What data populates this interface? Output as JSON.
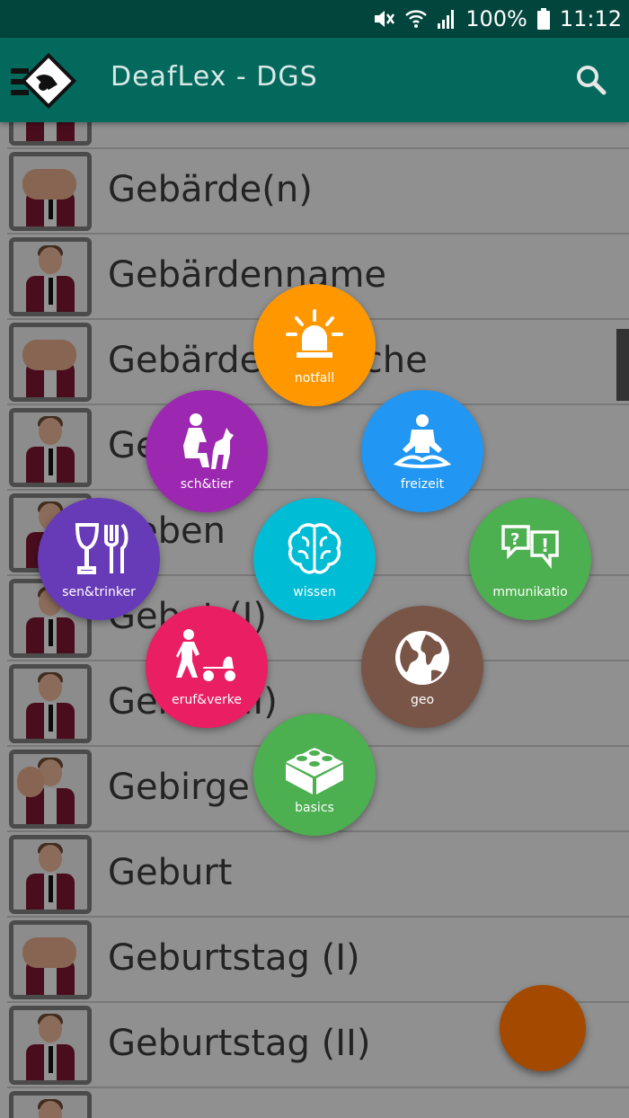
{
  "status_bar": {
    "battery": "100%",
    "time": "11:12"
  },
  "app_bar": {
    "title": "DeafLex - DGS"
  },
  "list": {
    "items": [
      {
        "label": ""
      },
      {
        "label": "Gebärde(n)"
      },
      {
        "label": "Gebärdenname"
      },
      {
        "label": "Gebärdensprache"
      },
      {
        "label": "Gehen"
      },
      {
        "label": "Geben"
      },
      {
        "label": "Gebet (I)"
      },
      {
        "label": "Gebet (II)"
      },
      {
        "label": "Gebirge"
      },
      {
        "label": "Geburt"
      },
      {
        "label": "Geburtstag (I)"
      },
      {
        "label": "Geburtstag (II)"
      },
      {
        "label": ""
      }
    ]
  },
  "radial_menu": {
    "notfall": {
      "label": "notfall",
      "color": "#ff9800"
    },
    "mensch_tier": {
      "label": "sch&tier",
      "color": "#9c27b0"
    },
    "freizeit": {
      "label": "freizeit",
      "color": "#2196f3"
    },
    "essen_trinken": {
      "label": "sen&trinker",
      "color": "#673ab7"
    },
    "wissen": {
      "label": "wissen",
      "color": "#00bcd4"
    },
    "kommunikation": {
      "label": "mmunikatio",
      "color": "#4caf50"
    },
    "beruf_verkehr": {
      "label": "eruf&verke",
      "color": "#e91e63"
    },
    "geo": {
      "label": "geo",
      "color": "#795548"
    },
    "basics": {
      "label": "basics",
      "color": "#4caf50"
    }
  },
  "fab": {
    "color": "#a34a00"
  },
  "icons": [
    "mute-icon",
    "wifi-icon",
    "signal-icon",
    "battery-icon",
    "logo-icon",
    "search-icon",
    "siren-icon",
    "person-dog-icon",
    "meditation-icon",
    "cutlery-icon",
    "brain-icon",
    "speech-bubbles-icon",
    "person-scooter-icon",
    "globe-icon",
    "lego-brick-icon"
  ]
}
